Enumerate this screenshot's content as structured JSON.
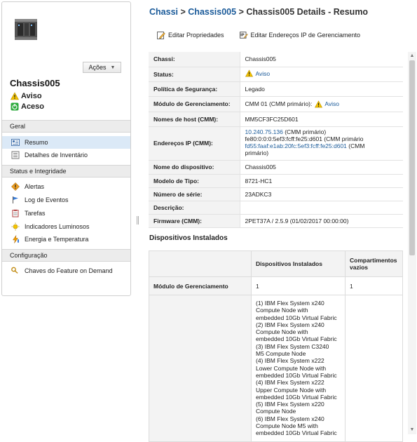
{
  "sidebar": {
    "device_name": "Chassis005",
    "actions_label": "Ações",
    "status": [
      {
        "label": "Aviso",
        "icon": "warning-icon"
      },
      {
        "label": "Aceso",
        "icon": "power-on-icon"
      }
    ],
    "sections": [
      {
        "label": "Geral",
        "items": [
          {
            "label": "Resumo",
            "icon": "summary-icon",
            "active": true
          },
          {
            "label": "Detalhes de Inventário",
            "icon": "inventory-icon"
          }
        ]
      },
      {
        "label": "Status e Integridade",
        "items": [
          {
            "label": "Alertas",
            "icon": "alert-icon"
          },
          {
            "label": "Log de Eventos",
            "icon": "flag-icon"
          },
          {
            "label": "Tarefas",
            "icon": "tasks-icon"
          },
          {
            "label": "Indicadores Luminosos",
            "icon": "light-icon"
          },
          {
            "label": "Energia e Temperatura",
            "icon": "power-temperature-icon"
          }
        ]
      },
      {
        "label": "Configuração",
        "items": [
          {
            "label": "Chaves do Feature on Demand",
            "icon": "key-icon"
          }
        ]
      }
    ]
  },
  "breadcrumb": {
    "root": "Chassi",
    "sep": ">",
    "parent": "Chassis005",
    "current": "Chassis005 Details - Resumo"
  },
  "toolbar": {
    "edit_props": "Editar Propriedades",
    "edit_ip": "Editar Endereços IP de Gerenciamento"
  },
  "properties": [
    {
      "key": "Chassi:",
      "value": "Chassis005"
    },
    {
      "key": "Status:",
      "value": "Aviso"
    },
    {
      "key": "Política de Segurança:",
      "value": "Legado"
    },
    {
      "key": "Módulo de Gerenciamento:",
      "value": "CMM 01 (CMM primário):",
      "value2": "Aviso"
    },
    {
      "key": "Nomes de host (CMM):",
      "value": "MM5CF3FC25D601"
    },
    {
      "key": "Endereços IP (CMM):",
      "ip_lines": [
        {
          "link": "10.240.75.136",
          "text": " (CMM primário)"
        },
        {
          "link": "",
          "text": "fe80:0:0:0:5ef3:fcff:fe25:d601 (CMM primário"
        },
        {
          "link": "fd55:faaf:e1ab:20fc:5ef3:fcff:fe25:d601",
          "text": " (CMM"
        },
        {
          "link": "",
          "text": "primário)"
        }
      ]
    },
    {
      "key": "Nome do dispositivo:",
      "value": "Chassis005"
    },
    {
      "key": "Modelo de Tipo:",
      "value": "8721-HC1"
    },
    {
      "key": "Número de série:",
      "value": "23ADKC3"
    },
    {
      "key": "Descrição:",
      "value": ""
    },
    {
      "key": "Firmware (CMM):",
      "value": "2PET37A / 2.5.9 (01/02/2017 00:00:00)"
    }
  ],
  "installed": {
    "title": "Dispositivos Instalados",
    "col_installed": "Dispositivos Instalados",
    "col_empty": "Compartimentos vazios",
    "row1_label": "Módulo de Gerenciamento",
    "row1_installed": "1",
    "row1_empty": "1",
    "row2_lines": [
      "(1) IBM Flex System x240",
      "Compute Node with",
      "embedded 10Gb Virtual Fabric",
      "(2) IBM Flex System x240",
      "Compute Node with",
      "embedded 10Gb Virtual Fabric",
      "(3) IBM Flex System C3240",
      "M5 Compute Node",
      "(4) IBM Flex System x222",
      "Lower Compute Node with",
      "embedded 10Gb Virtual Fabric",
      "(4) IBM Flex System x222",
      "Upper Compute Node with",
      "embedded 10Gb Virtual Fabric",
      "(5) IBM Flex System x220",
      "Compute Node",
      "(6) IBM Flex System x240",
      "Compute Node M5 with",
      "embedded 10Gb Virtual Fabric"
    ]
  },
  "colors": {
    "link": "#1a5a99",
    "active_nav": "#dbe9f7",
    "warning": "#f5c400",
    "power_on": "#2eaa3c"
  }
}
